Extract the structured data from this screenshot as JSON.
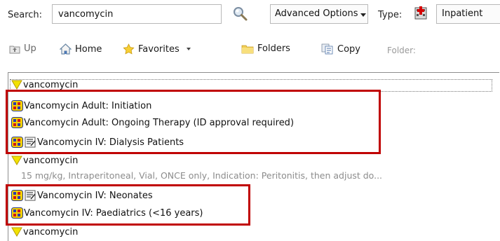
{
  "search": {
    "label": "Search:",
    "value": "vancomycin"
  },
  "advanced_options": {
    "label": "Advanced Options"
  },
  "type": {
    "label": "Type:",
    "value": "Inpatient"
  },
  "toolbar": {
    "up": "Up",
    "home": "Home",
    "favorites": "Favorites",
    "folders": "Folders",
    "copy": "Copy",
    "folder_label": "Folder:"
  },
  "results": [
    {
      "kind": "category",
      "text": "vancomycin"
    },
    {
      "kind": "careset",
      "text": "Vancomycin Adult: Initiation"
    },
    {
      "kind": "careset",
      "text": "Vancomycin Adult: Ongoing Therapy (ID approval required)"
    },
    {
      "kind": "careset-note",
      "text": "Vancomycin IV: Dialysis Patients"
    },
    {
      "kind": "category",
      "text": "vancomycin"
    },
    {
      "kind": "detail",
      "text": "15 mg/kg, Intraperitoneal, Vial, ONCE only, Indication: Peritonitis, then adjust do..."
    },
    {
      "kind": "careset-note",
      "text": "Vancomycin IV: Neonates"
    },
    {
      "kind": "careset",
      "text": "Vancomycin IV: Paediatrics (<16 years)"
    },
    {
      "kind": "category",
      "text": "vancomycin"
    }
  ],
  "colors": {
    "highlight": "#c00000",
    "category_triangle": "#f2e200",
    "careset_icon_bg": "#f4d000"
  }
}
